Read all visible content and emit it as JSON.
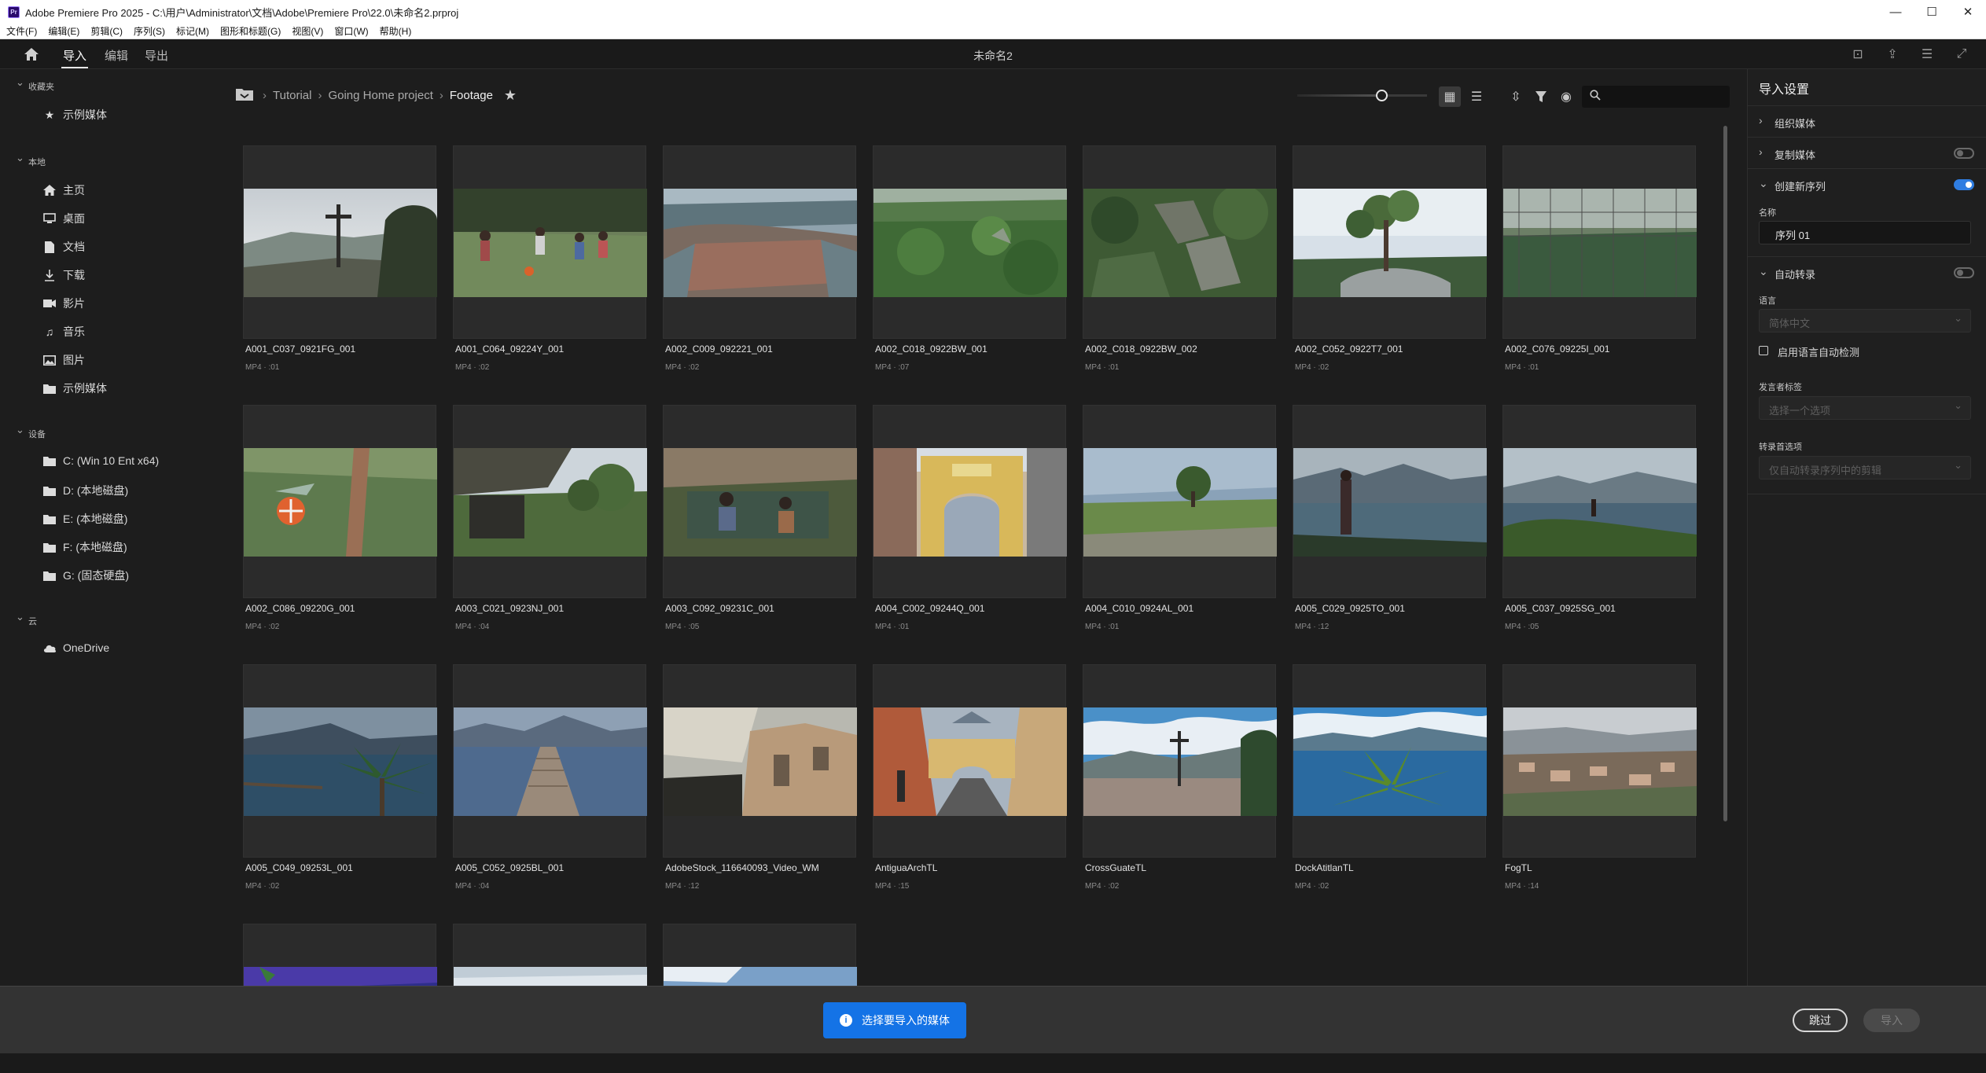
{
  "window": {
    "title": "Adobe Premiere Pro 2025 - C:\\用户\\Administrator\\文档\\Adobe\\Premiere Pro\\22.0\\未命名2.prproj",
    "app_icon": "Pr",
    "controls": [
      "—",
      "☐",
      "✕"
    ]
  },
  "menu": [
    "文件(F)",
    "编辑(E)",
    "剪辑(C)",
    "序列(S)",
    "标记(M)",
    "图形和标题(G)",
    "视图(V)",
    "窗口(W)",
    "帮助(H)"
  ],
  "header": {
    "tabs": [
      {
        "label": "导入",
        "active": true
      },
      {
        "label": "编辑",
        "active": false
      },
      {
        "label": "导出",
        "active": false
      }
    ],
    "project_name": "未命名2"
  },
  "sidebar": {
    "sections": [
      {
        "label": "收藏夹",
        "items": [
          {
            "label": "示例媒体",
            "icon": "star-icon"
          }
        ]
      },
      {
        "label": "本地",
        "items": [
          {
            "label": "主页",
            "icon": "home-icon"
          },
          {
            "label": "桌面",
            "icon": "desktop-icon"
          },
          {
            "label": "文档",
            "icon": "document-icon"
          },
          {
            "label": "下载",
            "icon": "download-icon"
          },
          {
            "label": "影片",
            "icon": "video-icon"
          },
          {
            "label": "音乐",
            "icon": "music-icon"
          },
          {
            "label": "图片",
            "icon": "image-icon"
          },
          {
            "label": "示例媒体",
            "icon": "folder-icon"
          }
        ]
      },
      {
        "label": "设备",
        "items": [
          {
            "label": "C: (Win 10 Ent x64)",
            "icon": "folder-icon"
          },
          {
            "label": "D: (本地磁盘)",
            "icon": "folder-icon"
          },
          {
            "label": "E: (本地磁盘)",
            "icon": "folder-icon"
          },
          {
            "label": "F: (本地磁盘)",
            "icon": "folder-icon"
          },
          {
            "label": "G: (固态硬盘)",
            "icon": "folder-icon"
          }
        ]
      },
      {
        "label": "云",
        "items": [
          {
            "label": "OneDrive",
            "icon": "cloud-icon"
          }
        ]
      }
    ]
  },
  "breadcrumb": [
    "Tutorial",
    "Going Home project",
    "Footage"
  ],
  "thumbnail_size": 0.6,
  "clips": [
    {
      "name": "A001_C037_0921FG_001",
      "meta": "MP4 · :01",
      "scene": "cross"
    },
    {
      "name": "A001_C064_09224Y_001",
      "meta": "MP4 · :02",
      "scene": "soccer"
    },
    {
      "name": "A002_C009_092221_001",
      "meta": "MP4 · :02",
      "scene": "town-aerial"
    },
    {
      "name": "A002_C018_0922BW_001",
      "meta": "MP4 · :07",
      "scene": "forest"
    },
    {
      "name": "A002_C018_0922BW_002",
      "meta": "MP4 · :01",
      "scene": "ruins"
    },
    {
      "name": "A002_C052_0922T7_001",
      "meta": "MP4 · :02",
      "scene": "tree-sky"
    },
    {
      "name": "A002_C076_09225I_001",
      "meta": "MP4 · :01",
      "scene": "field-fence"
    },
    {
      "name": "A002_C086_09220G_001",
      "meta": "MP4 · :02",
      "scene": "ball"
    },
    {
      "name": "A003_C021_0923NJ_001",
      "meta": "MP4 · :04",
      "scene": "hut"
    },
    {
      "name": "A003_C092_09231C_001",
      "meta": "MP4 · :05",
      "scene": "kids"
    },
    {
      "name": "A004_C002_09244Q_001",
      "meta": "MP4 · :01",
      "scene": "arch"
    },
    {
      "name": "A004_C010_0924AL_001",
      "meta": "MP4 · :01",
      "scene": "meadow"
    },
    {
      "name": "A005_C029_0925TO_001",
      "meta": "MP4 · :12",
      "scene": "lake-woman"
    },
    {
      "name": "A005_C037_0925SG_001",
      "meta": "MP4 · :05",
      "scene": "lake-cliff"
    },
    {
      "name": "A005_C049_09253L_001",
      "meta": "MP4 · :02",
      "scene": "lake-palm"
    },
    {
      "name": "A005_C052_0925BL_001",
      "meta": "MP4 · :04",
      "scene": "dock"
    },
    {
      "name": "AdobeStock_116640093_Video_WM",
      "meta": "MP4 · :12",
      "scene": "church"
    },
    {
      "name": "AntiguaArchTL",
      "meta": "MP4 · :15",
      "scene": "street"
    },
    {
      "name": "CrossGuateTL",
      "meta": "MP4 · :02",
      "scene": "cross-city"
    },
    {
      "name": "DockAtitlanTL",
      "meta": "MP4 · :02",
      "scene": "palm-blue"
    },
    {
      "name": "FogTL",
      "meta": "MP4 · :14",
      "scene": "town-fog"
    },
    {
      "name": "",
      "meta": "",
      "scene": "partial-purple"
    },
    {
      "name": "",
      "meta": "",
      "scene": "partial-sky"
    },
    {
      "name": "",
      "meta": "",
      "scene": "partial-sky2"
    }
  ],
  "import_settings": {
    "title": "导入设置",
    "organize_media": "组织媒体",
    "copy_media": {
      "label": "复制媒体",
      "enabled": false
    },
    "create_sequence": {
      "label": "创建新序列",
      "enabled": true
    },
    "name_label": "名称",
    "name_value": "序列 01",
    "auto_transcribe": {
      "label": "自动转录",
      "enabled": false
    },
    "language_label": "语言",
    "language_value": "简体中文",
    "auto_detect_label": "启用语言自动检测",
    "speaker_label": "发言者标签",
    "speaker_value": "选择一个选项",
    "transcribe_options_label": "转录首选项",
    "transcribe_options_value": "仅自动转录序列中的剪辑"
  },
  "bottom": {
    "info_button": "选择要导入的媒体",
    "skip_button": "跳过",
    "import_button": "导入"
  },
  "colors": {
    "accent": "#1473e6",
    "toggle_on": "#2f7de1"
  }
}
